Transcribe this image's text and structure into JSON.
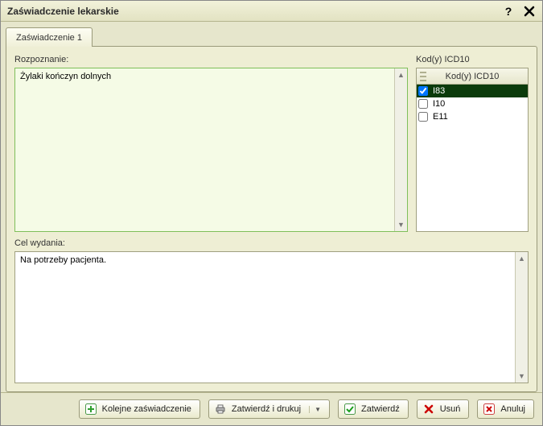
{
  "window": {
    "title": "Zaświadczenie lekarskie"
  },
  "tabs": [
    {
      "label": "Zaświadczenie 1"
    }
  ],
  "diagnosis": {
    "label": "Rozpoznanie:",
    "value": "Żylaki kończyn dolnych"
  },
  "icd": {
    "label": "Kod(y) ICD10",
    "column": "Kod(y) ICD10",
    "rows": [
      {
        "code": "I83",
        "checked": true,
        "selected": true
      },
      {
        "code": "I10",
        "checked": false,
        "selected": false
      },
      {
        "code": "E11",
        "checked": false,
        "selected": false
      }
    ]
  },
  "purpose": {
    "label": "Cel wydania:",
    "value": "Na potrzeby pacjenta."
  },
  "footer": {
    "next": "Kolejne zaświadczenie",
    "print": "Zatwierdź i drukuj",
    "approve": "Zatwierdź",
    "delete": "Usuń",
    "cancel": "Anuluj"
  }
}
